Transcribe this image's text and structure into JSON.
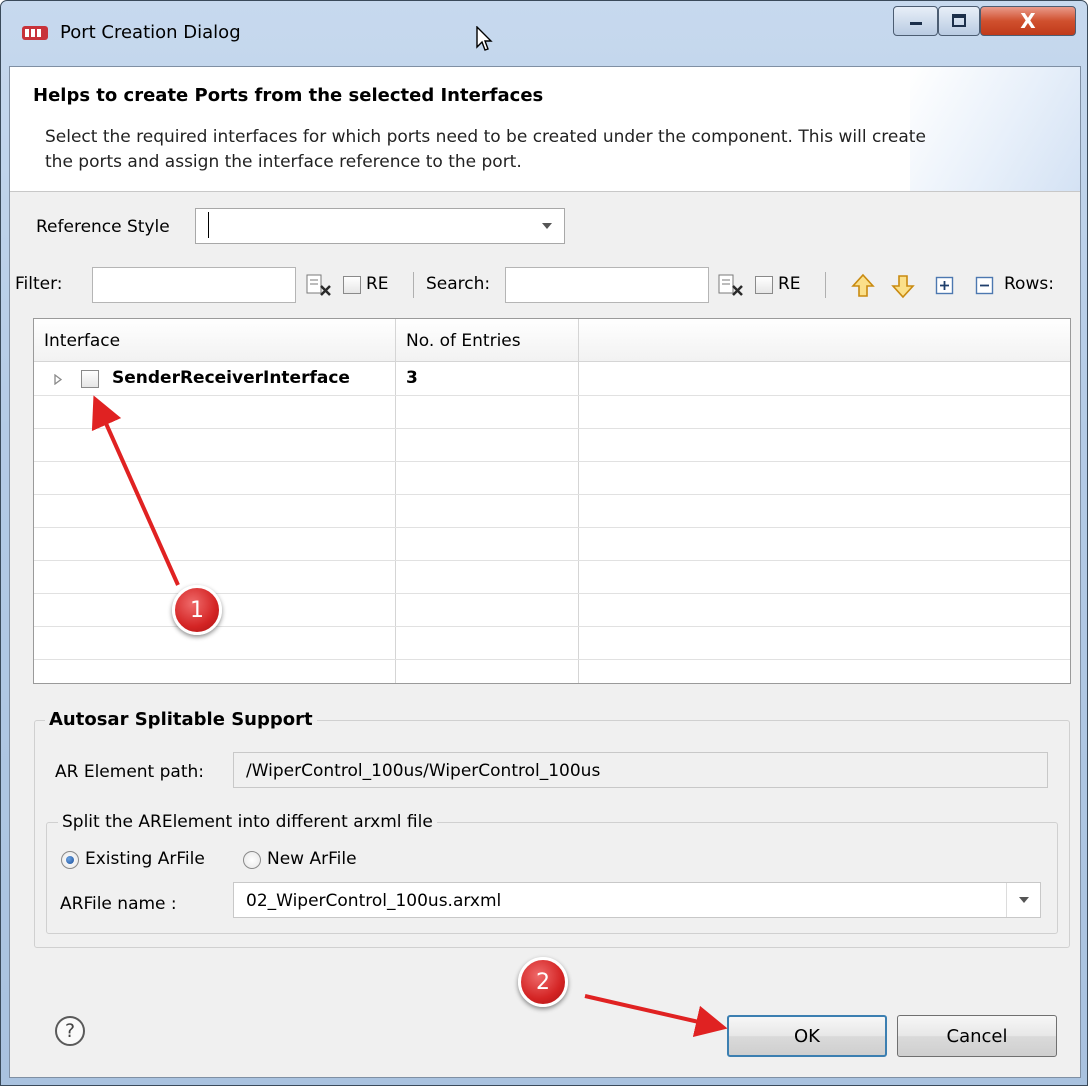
{
  "window": {
    "title": "Port Creation Dialog",
    "close_glyph": "X",
    "colors": {
      "titlebar": "#b4cbe6",
      "close": "#c7452a",
      "annotation": "#e02222"
    }
  },
  "header": {
    "title": "Helps to create Ports from the selected Interfaces",
    "description": "Select the required interfaces for which ports need to be created under the component. This will create the ports and assign the interface reference to the port."
  },
  "reference_style": {
    "label": "Reference Style",
    "value": ""
  },
  "filter_bar": {
    "filter_label": "Filter:",
    "filter_value": "",
    "filter_re_label": "RE",
    "search_label": "Search:",
    "search_value": "",
    "search_re_label": "RE",
    "rows_label": "Rows:"
  },
  "table": {
    "columns": [
      "Interface",
      "No. of Entries"
    ],
    "rows": [
      {
        "interface": "SenderReceiverInterface",
        "entries": "3",
        "checked": false,
        "expanded": false
      }
    ]
  },
  "splitable": {
    "group_title": "Autosar Splitable Support",
    "path_label": "AR Element path:",
    "path_value": "/WiperControl_100us/WiperControl_100us",
    "split_title": "Split the ARElement into different arxml file",
    "radio_existing": "Existing ArFile",
    "radio_new": "New ArFile",
    "selected_radio": "existing",
    "file_label": "ARFile name :",
    "file_value": "02_WiperControl_100us.arxml"
  },
  "footer": {
    "help_glyph": "?",
    "ok_label": "OK",
    "cancel_label": "Cancel"
  },
  "annotations": {
    "badge_1": "1",
    "badge_2": "2"
  }
}
